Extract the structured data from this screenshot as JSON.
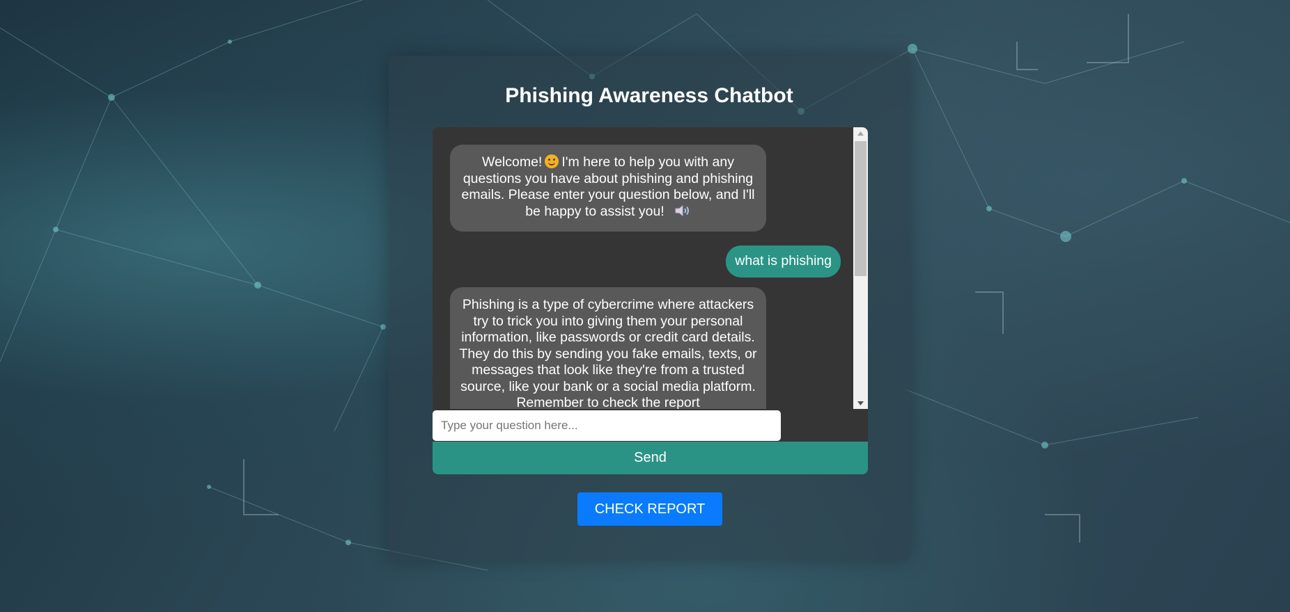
{
  "page": {
    "title": "Phishing Awareness Chatbot"
  },
  "chat": {
    "messages": [
      {
        "sender": "bot",
        "text_before_emoji": "Welcome!",
        "emoji": "smiling-face",
        "text_after_emoji": "I'm here to help you with any questions you have about phishing and phishing emails. Please enter your question below, and I'll be happy to assist you!",
        "has_speaker_icon": true
      },
      {
        "sender": "user",
        "text": "what is phishing"
      },
      {
        "sender": "bot",
        "text": "Phishing is a type of cybercrime where attackers try to trick you into giving them your personal information, like passwords or credit card details. They do this by sending you fake emails, texts, or messages that look like they're from a trusted source, like your bank or a social media platform. Remember to check the report"
      }
    ]
  },
  "input": {
    "placeholder": "Type your question here...",
    "value": ""
  },
  "buttons": {
    "send_label": "Send",
    "report_label": "CHECK REPORT"
  },
  "colors": {
    "bot_bubble": "#595959",
    "user_bubble": "#2b9487",
    "chat_background": "#353535",
    "send_button": "#2a9385",
    "report_button": "#0a7bff"
  },
  "icons": {
    "speaker": "speaker-icon",
    "emoji": "smiling-face-emoji-icon"
  }
}
